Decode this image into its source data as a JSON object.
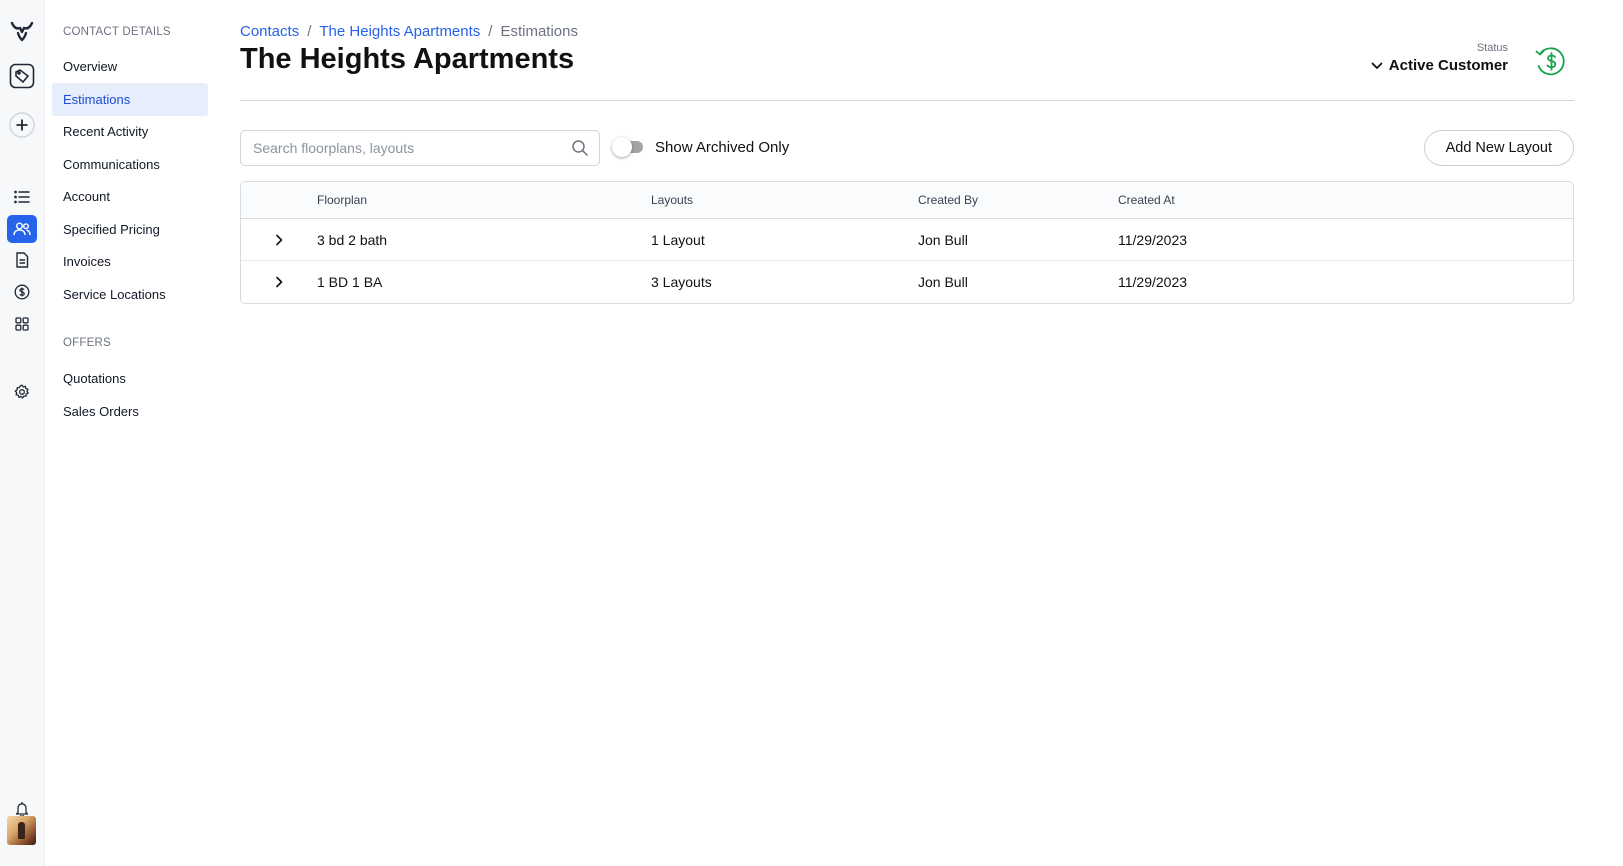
{
  "rail": {
    "icons": [
      "app-logo-icon",
      "tag-icon",
      "plus-icon",
      "list-icon",
      "contacts-icon",
      "document-icon",
      "dollar-circle-icon",
      "grid-icon",
      "gear-icon",
      "bell-icon"
    ],
    "active": "contacts-icon"
  },
  "sidebar": {
    "contact_details_header": "CONTACT DETAILS",
    "contact_items": [
      {
        "label": "Overview"
      },
      {
        "label": "Estimations",
        "active": true
      },
      {
        "label": "Recent Activity"
      },
      {
        "label": "Communications"
      },
      {
        "label": "Account"
      },
      {
        "label": "Specified Pricing"
      },
      {
        "label": "Invoices"
      },
      {
        "label": "Service Locations"
      }
    ],
    "offers_header": "OFFERS",
    "offer_items": [
      {
        "label": "Quotations"
      },
      {
        "label": "Sales Orders"
      }
    ]
  },
  "breadcrumb": {
    "items": [
      "Contacts",
      "The Heights Apartments",
      "Estimations"
    ],
    "separator": "/"
  },
  "page": {
    "title": "The Heights Apartments"
  },
  "status": {
    "label": "Status",
    "value": "Active Customer",
    "icon_color": "#16a34a"
  },
  "toolbar": {
    "search_placeholder": "Search floorplans, layouts",
    "search_value": "",
    "toggle_label": "Show Archived Only",
    "toggle_on": false,
    "add_button": "Add New Layout"
  },
  "table": {
    "columns": [
      "Floorplan",
      "Layouts",
      "Created By",
      "Created At"
    ],
    "rows": [
      {
        "floorplan": "3 bd 2 bath",
        "layouts": "1 Layout",
        "created_by": "Jon Bull",
        "created_at": "11/29/2023"
      },
      {
        "floorplan": "1 BD 1 BA",
        "layouts": "3 Layouts",
        "created_by": "Jon Bull",
        "created_at": "11/29/2023"
      }
    ]
  },
  "colors": {
    "accent": "#2563eb",
    "active_nav_bg": "#e6eefb",
    "status_green": "#16a34a"
  }
}
